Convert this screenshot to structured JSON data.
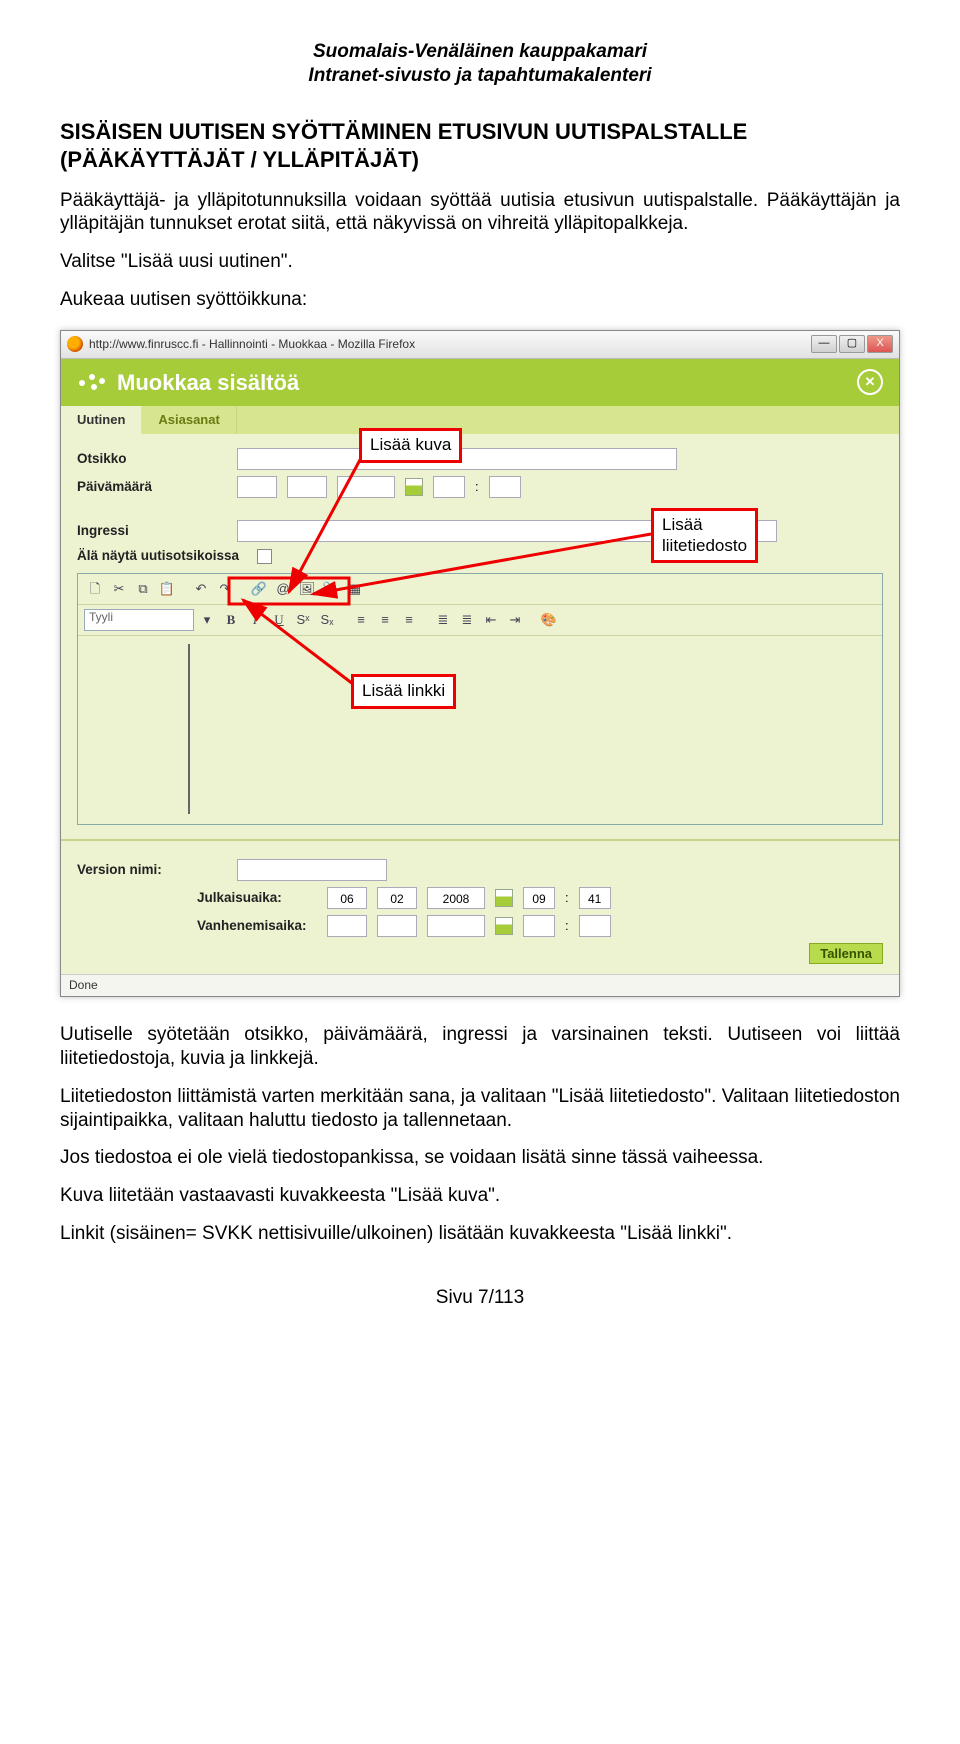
{
  "header": {
    "line1": "Suomalais-Venäläinen kauppakamari",
    "line2": "Intranet-sivusto ja tapahtumakalenteri"
  },
  "section_title": "SISÄISEN UUTISEN SYÖTTÄMINEN ETUSIVUN UUTISPALSTALLE (PÄÄKÄYTTÄJÄT / YLLÄPITÄJÄT)",
  "para1": "Pääkäyttäjä- ja ylläpitotunnuksilla voidaan syöttää uutisia etusivun uutispalstalle. Pääkäyttäjän ja ylläpitäjän tunnukset erotat siitä, että näkyvissä on vihreitä ylläpitopalkkeja.",
  "para2": "Valitse \"Lisää uusi uutinen\".",
  "para3": "Aukeaa uutisen syöttöikkuna:",
  "browser": {
    "title": "http://www.finruscc.fi - Hallinnointi - Muokkaa - Mozilla Firefox",
    "win_min": "—",
    "win_max": "▢",
    "win_close": "X",
    "greenbar_title": "Muokkaa sisältöä",
    "tabs": {
      "t1": "Uutinen",
      "t2": "Asiasanat"
    },
    "labels": {
      "otsikko": "Otsikko",
      "paivamaara": "Päivämäärä",
      "ingressi": "Ingressi",
      "ala_nayta": "Älä näytä uutisotsikoissa",
      "tyyli": "Tyyli",
      "version_nimi": "Version nimi:",
      "julkaisuaika": "Julkaisuaika:",
      "vanhenemisaika": "Vanhenemisaika:"
    },
    "publish": {
      "dd": "06",
      "mm": "02",
      "yyyy": "2008",
      "hh": "09",
      "min": "41"
    },
    "save": "Tallenna",
    "status": "Done"
  },
  "callouts": {
    "kuva": "Lisää kuva",
    "liite_l1": "Lisää",
    "liite_l2": "liitetiedosto",
    "linkki": "Lisää linkki"
  },
  "para4": "Uutiselle syötetään otsikko, päivämäärä, ingressi ja varsinainen teksti. Uutiseen voi liittää liitetiedostoja, kuvia ja linkkejä.",
  "para5": "Liitetiedoston liittämistä varten merkitään sana, ja valitaan \"Lisää liitetiedosto\". Valitaan liitetiedoston sijaintipaikka, valitaan haluttu tiedosto ja tallennetaan.",
  "para6": "Jos tiedostoa ei ole vielä tiedostopankissa, se voidaan lisätä sinne tässä vaiheessa.",
  "para7": "Kuva liitetään vastaavasti kuvakkeesta \"Lisää kuva\".",
  "para8": "Linkit (sisäinen= SVKK nettisivuille/ulkoinen) lisätään kuvakkeesta \"Lisää linkki\".",
  "footer": "Sivu 7/113"
}
